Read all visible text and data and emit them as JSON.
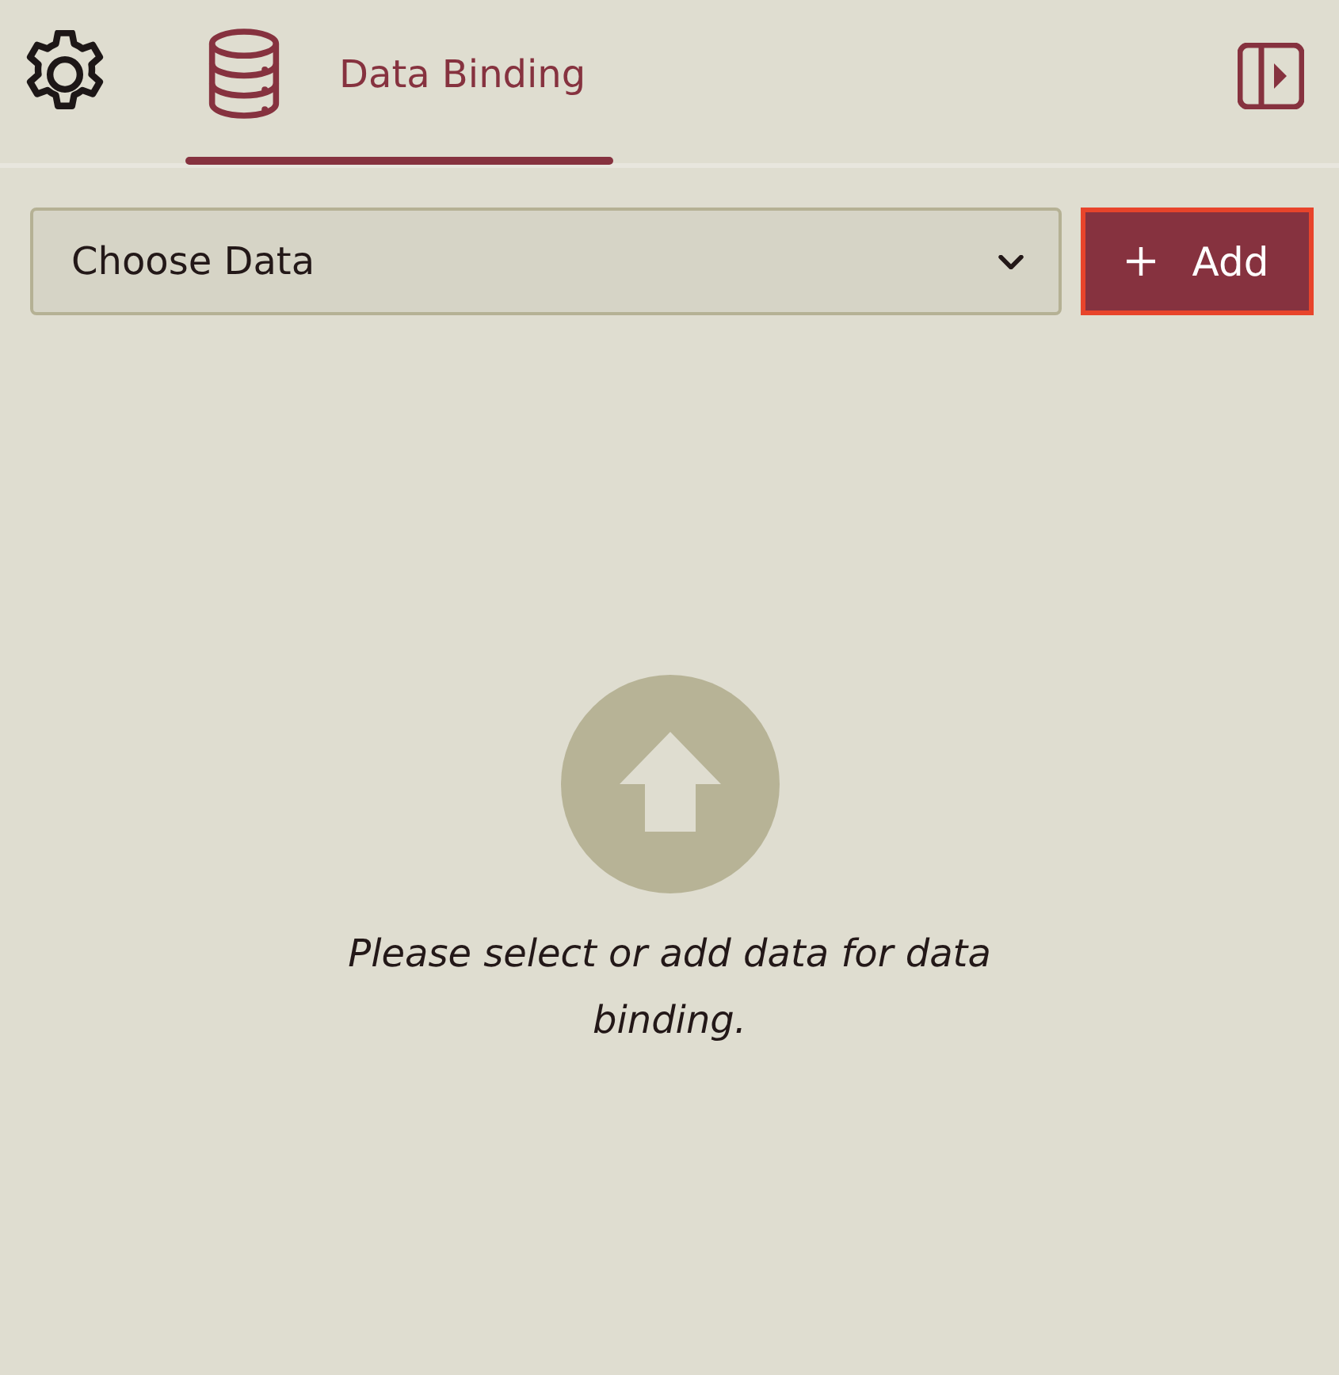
{
  "tabs": [
    {
      "kind": "settings",
      "selected": false
    },
    {
      "kind": "data",
      "label": "Data Binding",
      "selected": true
    }
  ],
  "toolbar": {
    "data_select": {
      "placeholder": "Choose Data"
    },
    "add_button": {
      "label": "Add",
      "focused": true
    }
  },
  "empty_state": {
    "message": "Please select or add data for data binding."
  }
}
